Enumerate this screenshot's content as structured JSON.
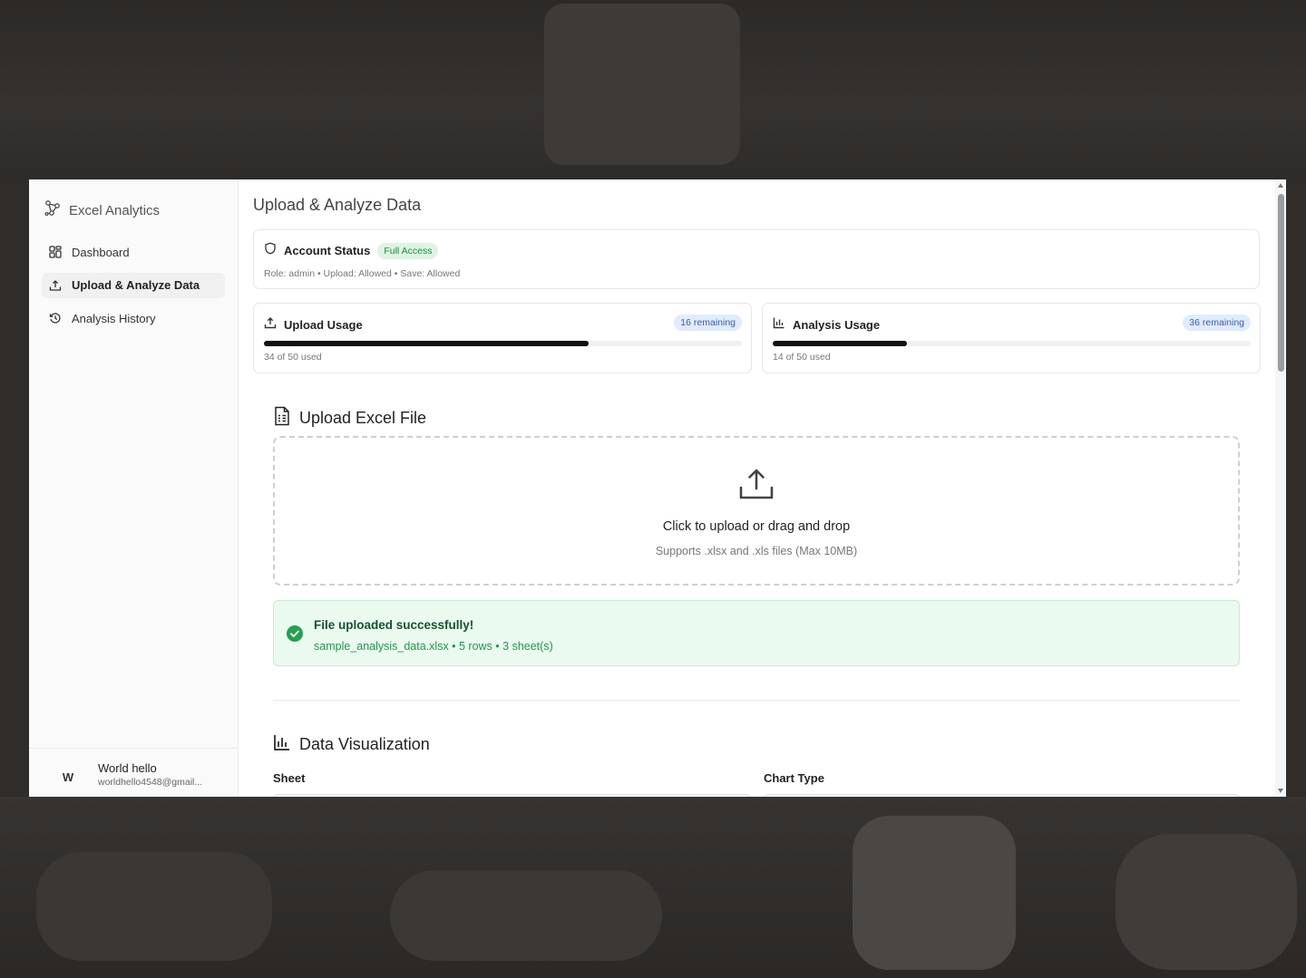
{
  "sidebar": {
    "brand": "Excel Analytics",
    "items": [
      {
        "label": "Dashboard",
        "icon": "dashboard-icon"
      },
      {
        "label": "Upload & Analyze Data",
        "icon": "upload-icon",
        "active": true
      },
      {
        "label": "Analysis History",
        "icon": "history-icon"
      }
    ],
    "user": {
      "initial": "W",
      "name": "World hello",
      "email": "worldhello4548@gmail..."
    }
  },
  "main": {
    "title": "Upload & Analyze Data",
    "account_status": {
      "title": "Account Status",
      "badge": "Full Access",
      "details": "Role: admin • Upload: Allowed • Save: Allowed"
    },
    "upload_usage": {
      "title": "Upload Usage",
      "badge": "16 remaining",
      "used_text": "34 of 50 used",
      "fraction": 0.68
    },
    "analysis_usage": {
      "title": "Analysis Usage",
      "badge": "36 remaining",
      "used_text": "14 of 50 used",
      "fraction": 0.28
    },
    "upload_section": {
      "title": "Upload Excel File",
      "drop_main": "Click to upload or drag and drop",
      "drop_sub": "Supports .xlsx and .xls files (Max 10MB)",
      "success_title": "File uploaded successfully!",
      "success_sub": "sample_analysis_data.xlsx • 5 rows • 3 sheet(s)"
    },
    "visualization": {
      "title": "Data Visualization",
      "sheet_label": "Sheet",
      "chart_type_label": "Chart Type"
    }
  },
  "colors": {
    "accent": "#111111",
    "success": "#1e9a4a",
    "badge_blue": "#3a5fb0"
  }
}
